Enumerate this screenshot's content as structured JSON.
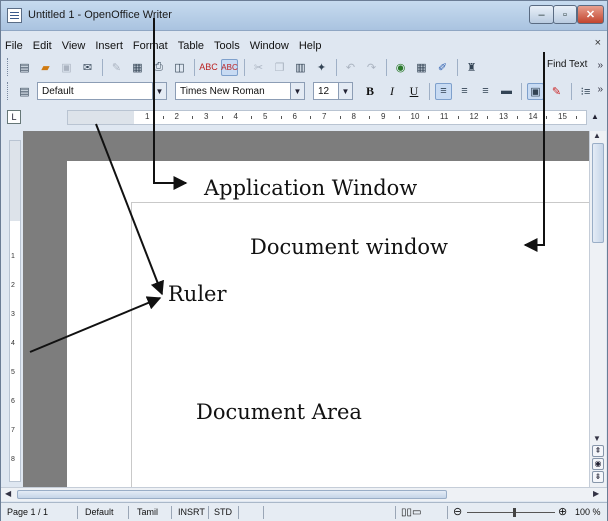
{
  "window": {
    "title": "Untitled 1 - OpenOffice Writer",
    "close_glyph": "✕",
    "minimize_glyph": "–",
    "maximize_glyph": "▫"
  },
  "menu": {
    "items": [
      "File",
      "Edit",
      "View",
      "Insert",
      "Format",
      "Table",
      "Tools",
      "Window",
      "Help"
    ],
    "close": "×"
  },
  "toolbar": {
    "icons": [
      "new-icon",
      "open-icon",
      "save-icon",
      "email-icon",
      "edit-file-icon",
      "pdf-icon",
      "print-icon",
      "print-preview-icon",
      "spellcheck-icon",
      "autospell-icon",
      "cut-icon",
      "copy-icon",
      "paste-icon",
      "clone-format-icon",
      "undo-icon",
      "redo-icon",
      "navigator-icon",
      "table-icon",
      "draw-icon",
      "find-replace-icon"
    ],
    "find_label": "Find Text",
    "more": "»"
  },
  "formatting": {
    "style": "Default",
    "font": "Times New Roman",
    "size": "12",
    "bold": "B",
    "italic": "I",
    "underline": "U"
  },
  "ruler": {
    "tab_selector": "L",
    "h_numbers": [
      "1",
      "2",
      "3",
      "4",
      "5",
      "6",
      "7",
      "8",
      "9",
      "10",
      "11",
      "12",
      "13",
      "14",
      "15"
    ],
    "v_numbers": [
      "1",
      "2",
      "3",
      "4",
      "5",
      "6",
      "7",
      "8"
    ]
  },
  "status": {
    "page": "Page 1 / 1",
    "style": "Default",
    "language": "Tamil",
    "insert_mode": "INSRT",
    "selection_mode": "STD",
    "zoom": "100 %"
  },
  "annotations": {
    "application_window": "Application Window",
    "document_window": "Document window",
    "ruler": "Ruler",
    "document_area": "Document Area"
  }
}
